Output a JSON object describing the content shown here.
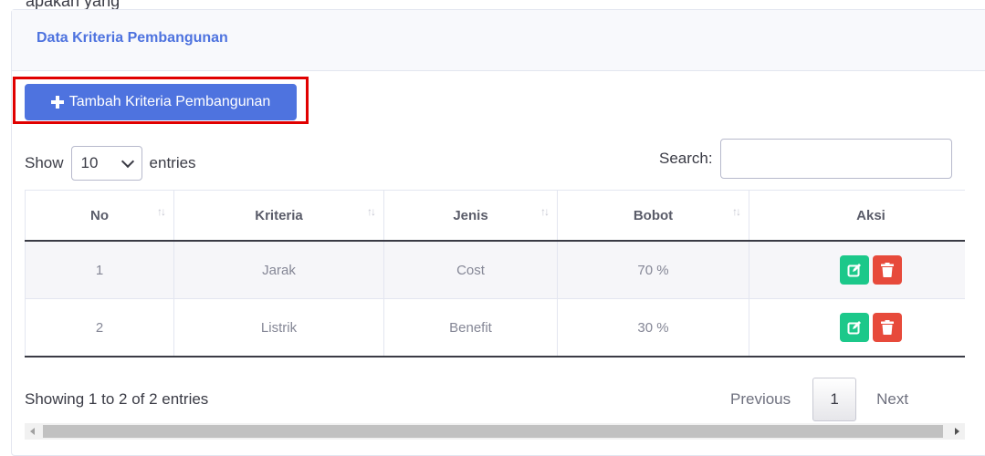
{
  "top_cut_text": "apakah yang",
  "card": {
    "title": "Data Kriteria Pembangunan",
    "add_button": "Tambah Kriteria Pembangunan"
  },
  "length": {
    "show": "Show",
    "value": "10",
    "entries": "entries"
  },
  "search": {
    "label": "Search:",
    "value": ""
  },
  "table": {
    "headers": [
      "No",
      "Kriteria",
      "Jenis",
      "Bobot",
      "Aksi"
    ],
    "rows": [
      {
        "no": "1",
        "kriteria": "Jarak",
        "jenis": "Cost",
        "bobot": "70 %"
      },
      {
        "no": "2",
        "kriteria": "Listrik",
        "jenis": "Benefit",
        "bobot": "30 %"
      }
    ]
  },
  "info": "Showing 1 to 2 of 2 entries",
  "pagination": {
    "previous": "Previous",
    "current": "1",
    "next": "Next"
  },
  "icons": {
    "add": "plus-icon",
    "edit": "edit-icon",
    "delete": "trash-icon",
    "sort": "sort-icon"
  },
  "colors": {
    "primary": "#4e73df",
    "success": "#1cc88a",
    "danger": "#e74a3b",
    "highlight": "#e00000"
  }
}
